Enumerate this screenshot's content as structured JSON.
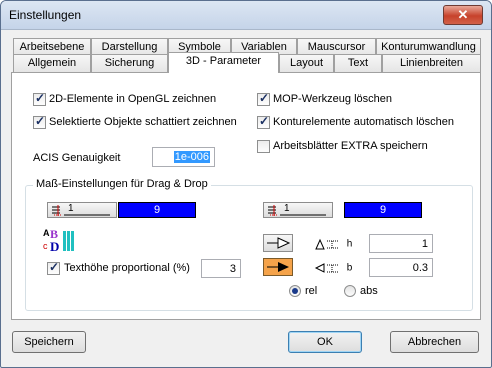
{
  "window": {
    "title": "Einstellungen",
    "close_glyph": "✕"
  },
  "tabs": {
    "row1": [
      "Arbeitsebene",
      "Darstellung",
      "Symbole",
      "Variablen",
      "Mauscursor",
      "Konturumwandlung"
    ],
    "row2": [
      "Allgemein",
      "Sicherung",
      "3D - Parameter",
      "Layout",
      "Text",
      "Linienbreiten"
    ],
    "active": "3D - Parameter"
  },
  "options": {
    "left": [
      {
        "label": "2D-Elemente in OpenGL zeichnen",
        "checked": true
      },
      {
        "label": "Selektierte Objekte schattiert zeichnen",
        "checked": true
      }
    ],
    "right": [
      {
        "label": "MOP-Werkzeug löschen",
        "checked": true
      },
      {
        "label": "Konturelemente automatisch löschen",
        "checked": true
      },
      {
        "label": "Arbeitsblätter EXTRA speichern",
        "checked": false
      }
    ]
  },
  "acis": {
    "label": "ACIS Genauigkeit",
    "value": "1e-006"
  },
  "dim_group": {
    "title": "Maß-Einstellungen für Drag & Drop",
    "left_color_value": "9",
    "right_color_value": "9",
    "dim_button_text": "1",
    "text_height": {
      "label": "Texthöhe proportional (%)",
      "checked": true,
      "value": "3"
    },
    "h_label": "h",
    "h_value": "1",
    "b_label": "b",
    "b_value": "0.3",
    "radio_rel": "rel",
    "radio_abs": "abs",
    "selected": "rel",
    "color_accent": "#0000ff"
  },
  "buttons": {
    "save": "Speichern",
    "ok": "OK",
    "cancel": "Abbrechen"
  }
}
